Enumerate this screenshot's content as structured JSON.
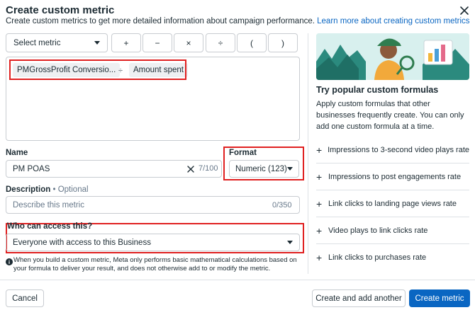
{
  "dialog": {
    "title": "Create custom metric",
    "subtitle": "Create custom metrics to get more detailed information about campaign performance.",
    "learn_more": "Learn more about creating custom metrics"
  },
  "toolbar": {
    "select_metric": "Select metric",
    "operators": [
      "+",
      "−",
      "×",
      "÷",
      "(",
      ")"
    ]
  },
  "formula": {
    "token_1": "PMGrossProfit Conversio...",
    "operator": "÷",
    "token_2": "Amount spent"
  },
  "name": {
    "label": "Name",
    "value": "PM POAS",
    "count": "7/100"
  },
  "format": {
    "label": "Format",
    "value": "Numeric (123)"
  },
  "description": {
    "label": "Description",
    "optional": "Optional",
    "separator": "•",
    "placeholder": "Describe this metric",
    "count": "0/350"
  },
  "access": {
    "label": "Who can access this?",
    "value": "Everyone with access to this Business"
  },
  "info": {
    "text": "When you build a custom metric, Meta only performs basic mathematical calculations based on your formula to deliver your result, and does not otherwise add to or modify the metric."
  },
  "popular": {
    "title": "Try popular custom formulas",
    "description": "Apply custom formulas that other businesses frequently create. You can only add one custom formula at a time.",
    "items": [
      "Impressions to 3-second video plays rate",
      "Impressions to post engagements rate",
      "Link clicks to landing page views rate",
      "Video plays to link clicks rate",
      "Link clicks to purchases rate"
    ]
  },
  "footer": {
    "cancel": "Cancel",
    "create_another": "Create and add another",
    "create": "Create metric"
  },
  "colors": {
    "primary": "#0a66c2",
    "highlight": "#e02020",
    "border": "#c8ccd1"
  }
}
